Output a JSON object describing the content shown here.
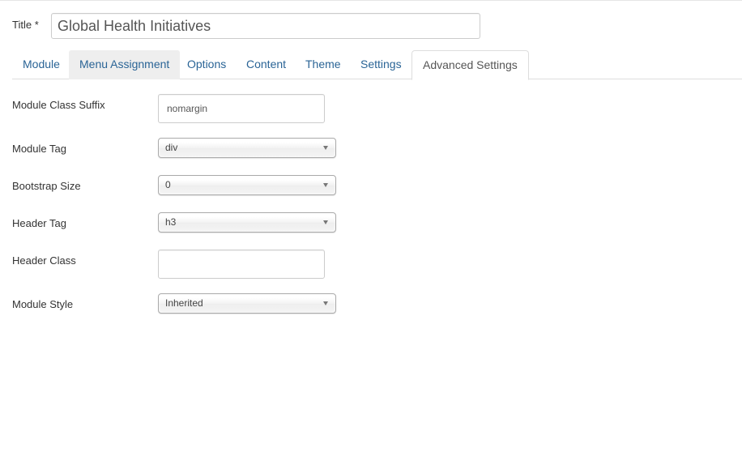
{
  "title_field": {
    "label": "Title *",
    "value": "Global Health Initiatives"
  },
  "tabs": [
    {
      "label": "Module"
    },
    {
      "label": "Menu Assignment"
    },
    {
      "label": "Options"
    },
    {
      "label": "Content"
    },
    {
      "label": "Theme"
    },
    {
      "label": "Settings"
    },
    {
      "label": "Advanced Settings"
    }
  ],
  "active_tab": "Advanced Settings",
  "advanced": {
    "module_class_suffix": {
      "label": "Module Class Suffix",
      "value": "nomargin"
    },
    "module_tag": {
      "label": "Module Tag",
      "value": "div"
    },
    "bootstrap_size": {
      "label": "Bootstrap Size",
      "value": "0"
    },
    "header_tag": {
      "label": "Header Tag",
      "value": "h3"
    },
    "header_class": {
      "label": "Header Class",
      "value": ""
    },
    "module_style": {
      "label": "Module Style",
      "value": "Inherited"
    }
  },
  "colors": {
    "link": "#2a6496",
    "active_tab_text": "#555555",
    "border": "#dddddd"
  }
}
